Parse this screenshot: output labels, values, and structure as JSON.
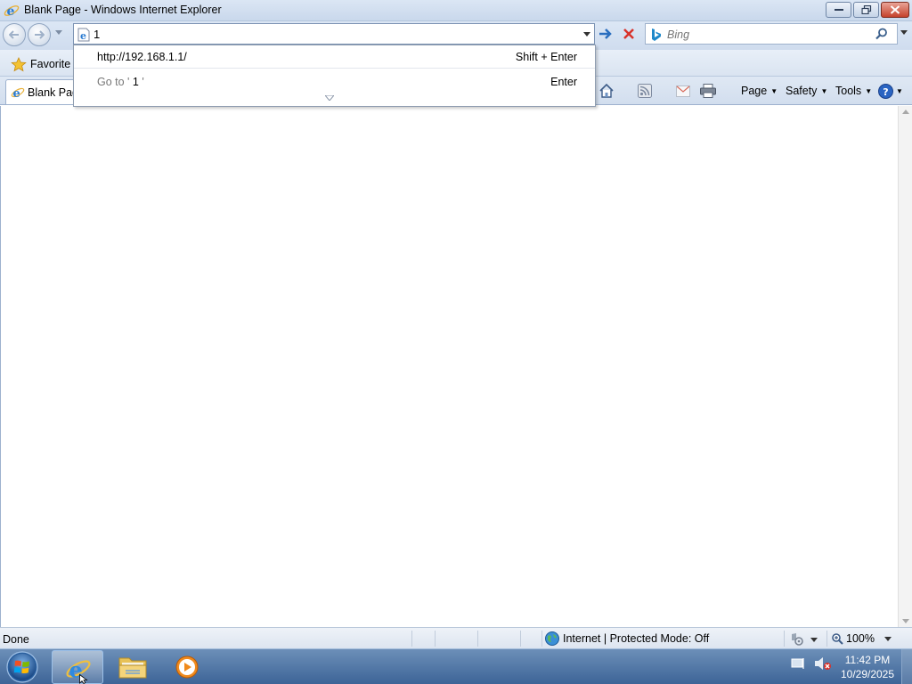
{
  "window": {
    "title": "Blank Page - Windows Internet Explorer"
  },
  "address_bar": {
    "value": "1"
  },
  "search_box": {
    "placeholder": "Bing"
  },
  "autocomplete": {
    "suggestion_url": "http://192.168.1.1/",
    "suggestion_shortcut": "Shift + Enter",
    "goto_prefix": "Go to '",
    "goto_value": " 1 ",
    "goto_suffix": "'",
    "goto_shortcut": "Enter"
  },
  "favorites_bar": {
    "label": "Favorite"
  },
  "tabs": [
    {
      "label": "Blank Pag"
    }
  ],
  "command_bar": {
    "page": "Page",
    "safety": "Safety",
    "tools": "Tools"
  },
  "status_bar": {
    "text": "Done",
    "zone": "Internet | Protected Mode: Off",
    "zoom": "100%"
  },
  "taskbar": {
    "time": "11:42 PM",
    "date": "10/29/2025"
  },
  "colors": {
    "accent": "#1f6fc5",
    "stop": "#d8322a",
    "titlebar": "#c9d8ec",
    "taskbar": "#3d6497"
  }
}
